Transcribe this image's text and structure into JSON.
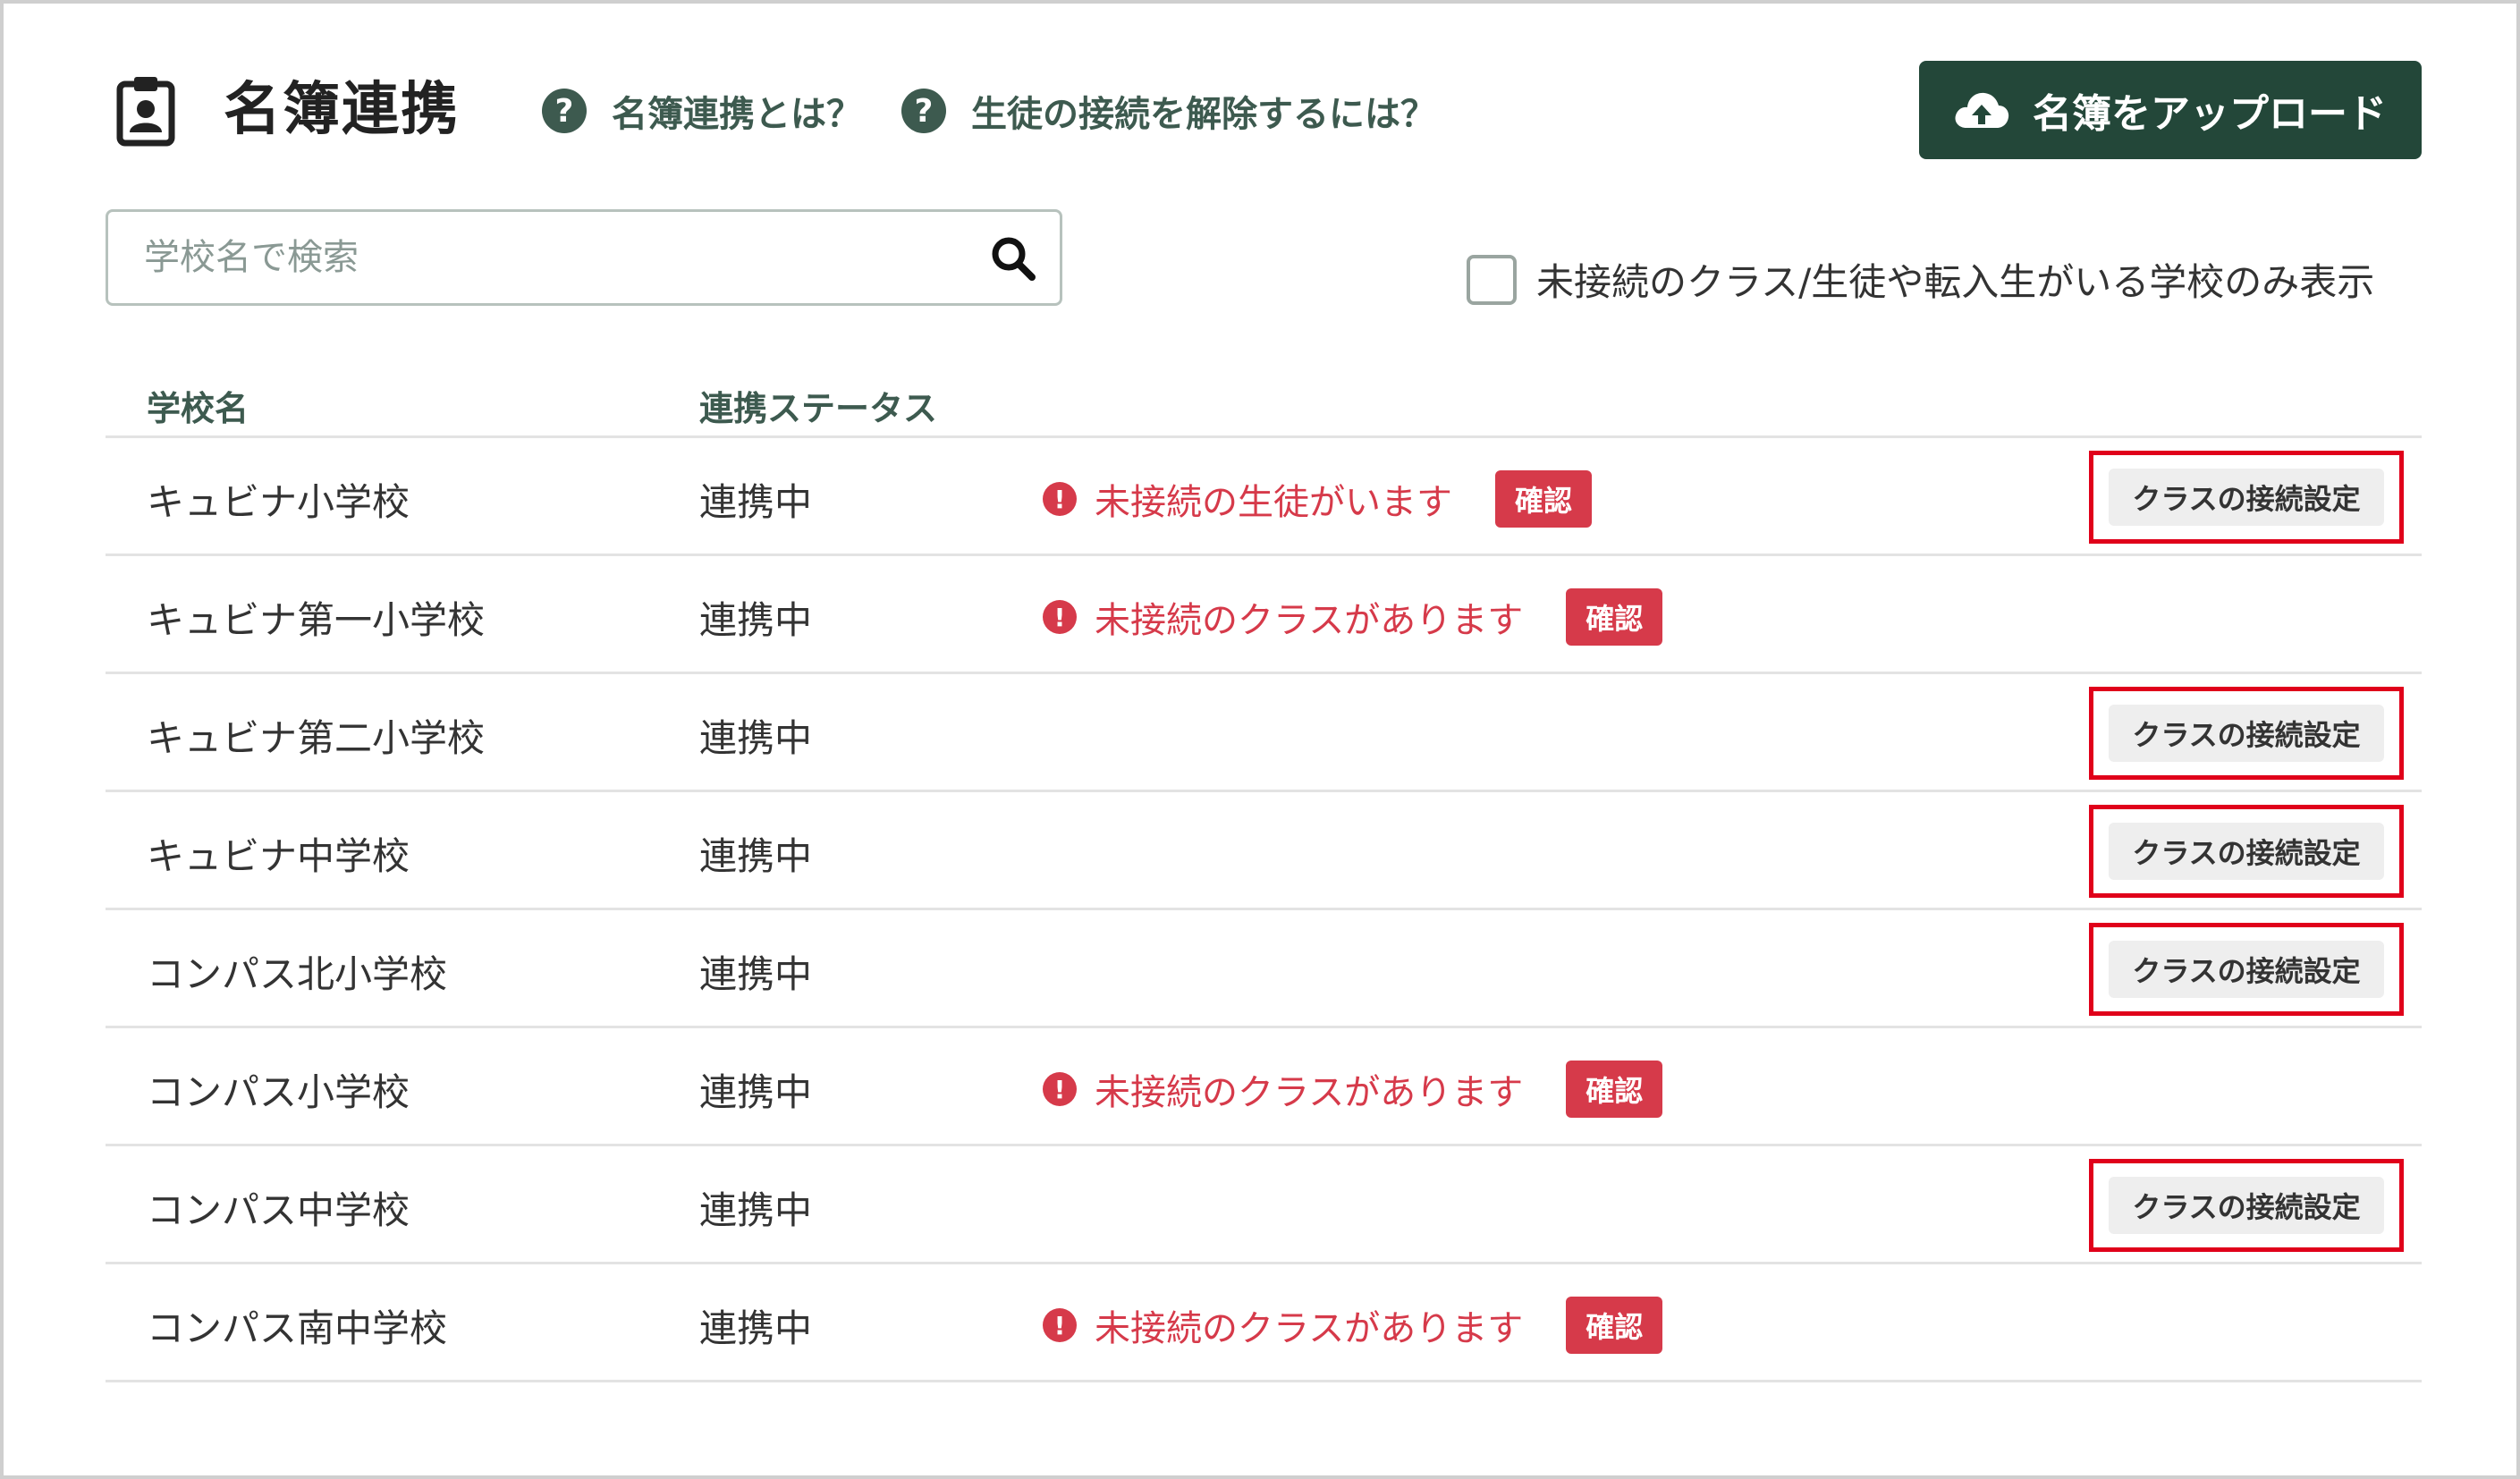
{
  "header": {
    "title": "名簿連携",
    "help_links": [
      "名簿連携とは？",
      "生徒の接続を解除するには？"
    ],
    "help_icon_glyph": "?",
    "upload_label": "名簿をアップロード"
  },
  "search": {
    "placeholder": "学校名で検索",
    "value": ""
  },
  "filter": {
    "label": "未接続のクラス/生徒や転入生がいる学校のみ表示",
    "checked": false
  },
  "table": {
    "columns": [
      "学校名",
      "連携ステータス"
    ],
    "confirm_label": "確認",
    "connect_label": "クラスの接続設定",
    "rows": [
      {
        "name": "キュビナ小学校",
        "status": "連携中",
        "alert": "未接続の生徒がいます",
        "connect": true
      },
      {
        "name": "キュビナ第一小学校",
        "status": "連携中",
        "alert": "未接続のクラスがあります",
        "connect": false
      },
      {
        "name": "キュビナ第二小学校",
        "status": "連携中",
        "alert": "",
        "connect": true
      },
      {
        "name": "キュビナ中学校",
        "status": "連携中",
        "alert": "",
        "connect": true
      },
      {
        "name": "コンパス北小学校",
        "status": "連携中",
        "alert": "",
        "connect": true
      },
      {
        "name": "コンパス小学校",
        "status": "連携中",
        "alert": "未接続のクラスがあります",
        "connect": false
      },
      {
        "name": "コンパス中学校",
        "status": "連携中",
        "alert": "",
        "connect": true
      },
      {
        "name": "コンパス南中学校",
        "status": "連携中",
        "alert": "未接続のクラスがあります",
        "connect": false
      }
    ]
  },
  "colors": {
    "brand_dark_green": "#234739",
    "label_green": "#3d5a4f",
    "alert_red": "#d63a4a",
    "highlight_red": "#e0001a"
  },
  "icons": {
    "title": "clipboard-user-icon",
    "help": "question-circle-icon",
    "upload": "cloud-upload-icon",
    "search": "magnifier-icon",
    "alert": "exclamation-circle-icon"
  }
}
